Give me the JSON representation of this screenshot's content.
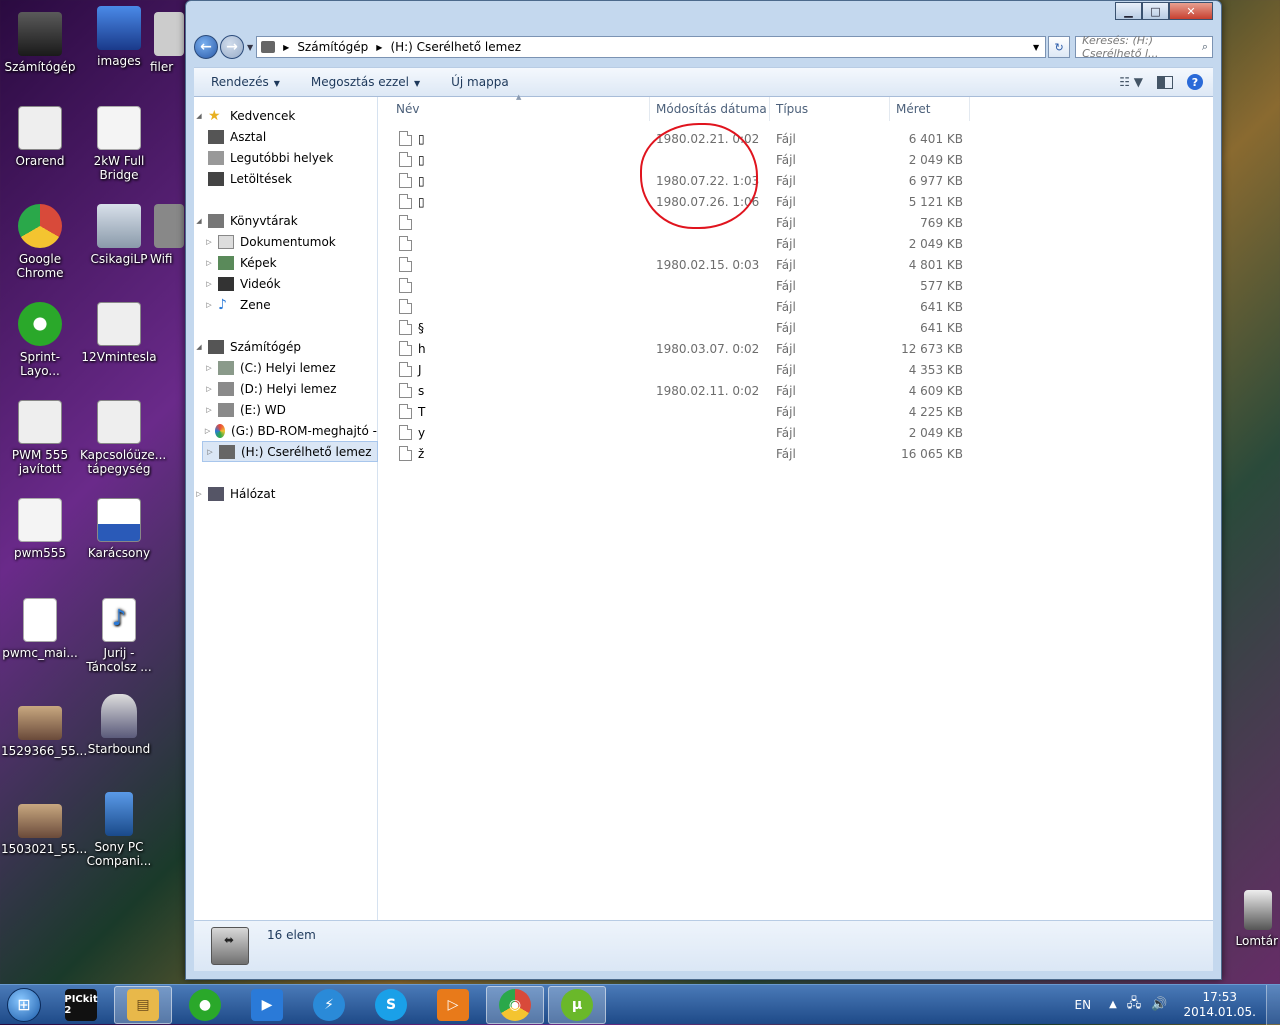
{
  "desktop": {
    "icons": [
      {
        "label": "Számítógép",
        "color": "#3a3a3a"
      },
      {
        "label": "images",
        "color": "#1a4a9a"
      },
      {
        "label": "filer",
        "color": "#cccccc"
      },
      {
        "label": "Orarend",
        "color": "#e8e8e8"
      },
      {
        "label": "2kW Full Bridge",
        "color": "#f0f0f0"
      },
      {
        "label": "Google Chrome",
        "color": "#d84a3a"
      },
      {
        "label": "CsikagiLP",
        "color": "#a8b8c8"
      },
      {
        "label": "Wifi",
        "color": "#888888"
      },
      {
        "label": "Sprint-Layo...",
        "color": "#2aa82a"
      },
      {
        "label": "12Vmintesla",
        "color": "#e0e0e0"
      },
      {
        "label": "PWM 555 javított",
        "color": "#e0e0e0"
      },
      {
        "label": "Kapcsolóüze... tápegység",
        "color": "#e0e0e0"
      },
      {
        "label": "pwm555",
        "color": "#f0f0f0"
      },
      {
        "label": "Karácsony",
        "color": "#2a5ab8"
      },
      {
        "label": "pwmc_mai...",
        "color": "#ffffff"
      },
      {
        "label": "Jurij - Táncolsz ...",
        "color": "#2a7ad8"
      },
      {
        "label": "1529366_55...",
        "color": "#8a5a4a"
      },
      {
        "label": "Starbound",
        "color": "#5a5a7a"
      },
      {
        "label": "1503021_55...",
        "color": "#8a5a4a"
      },
      {
        "label": "Sony PC Compani...",
        "color": "#2a6ab8"
      },
      {
        "label": "Lomtár",
        "color": "#6a6a6a"
      }
    ]
  },
  "window": {
    "controls": {
      "minimize": "▁",
      "maximize": "□",
      "close": "✕"
    },
    "address": {
      "root": "Számítógép",
      "current": "(H:) Cserélhető lemez"
    },
    "search": {
      "placeholder": "Keresés: (H:) Cserélhető l..."
    },
    "toolbar": {
      "organize": "Rendezés",
      "share": "Megosztás ezzel",
      "new_folder": "Új mappa"
    },
    "nav": {
      "favorites": "Kedvencek",
      "desktop": "Asztal",
      "recent": "Legutóbbi helyek",
      "downloads": "Letöltések",
      "libraries": "Könyvtárak",
      "documents": "Dokumentumok",
      "pictures": "Képek",
      "videos": "Videók",
      "music": "Zene",
      "computer": "Számítógép",
      "drive_c": "(C:) Helyi lemez",
      "drive_d": "(D:) Helyi lemez",
      "drive_e": "(E:) WD",
      "drive_g": "(G:) BD-ROM-meghajtó -",
      "drive_h": "(H:) Cserélhető lemez",
      "network": "Hálózat"
    },
    "columns": {
      "name": "Név",
      "date": "Módosítás dátuma",
      "type": "Típus",
      "size": "Méret"
    },
    "files": [
      {
        "name": "▯",
        "date": "1980.02.21. 0:02",
        "type": "Fájl",
        "size": "6 401 KB"
      },
      {
        "name": "▯",
        "date": "",
        "type": "Fájl",
        "size": "2 049 KB"
      },
      {
        "name": "▯",
        "date": "1980.07.22. 1:03",
        "type": "Fájl",
        "size": "6 977 KB"
      },
      {
        "name": "▯",
        "date": "1980.07.26. 1:06",
        "type": "Fájl",
        "size": "5 121 KB"
      },
      {
        "name": "",
        "date": "",
        "type": "Fájl",
        "size": "769 KB"
      },
      {
        "name": "",
        "date": "",
        "type": "Fájl",
        "size": "2 049 KB"
      },
      {
        "name": "",
        "date": "1980.02.15. 0:03",
        "type": "Fájl",
        "size": "4 801 KB"
      },
      {
        "name": "",
        "date": "",
        "type": "Fájl",
        "size": "577 KB"
      },
      {
        "name": "",
        "date": "",
        "type": "Fájl",
        "size": "641 KB"
      },
      {
        "name": "§",
        "date": "",
        "type": "Fájl",
        "size": "641 KB"
      },
      {
        "name": "h",
        "date": "1980.03.07. 0:02",
        "type": "Fájl",
        "size": "12 673 KB"
      },
      {
        "name": "J",
        "date": "",
        "type": "Fájl",
        "size": "4 353 KB"
      },
      {
        "name": "s",
        "date": "1980.02.11. 0:02",
        "type": "Fájl",
        "size": "4 609 KB"
      },
      {
        "name": "T",
        "date": "",
        "type": "Fájl",
        "size": "4 225 KB"
      },
      {
        "name": "y",
        "date": "",
        "type": "Fájl",
        "size": "2 049 KB"
      },
      {
        "name": "ž",
        "date": "",
        "type": "Fájl",
        "size": "16 065 KB"
      }
    ],
    "status": {
      "count": "16 elem"
    }
  },
  "taskbar": {
    "apps": [
      {
        "name": "pickit",
        "label": "PICkit 2",
        "color": "#111111",
        "active": false
      },
      {
        "name": "explorer",
        "label": "▤",
        "color": "#e8b84a",
        "active": true
      },
      {
        "name": "sprint-layout",
        "label": "●",
        "color": "#2aa82a",
        "active": false
      },
      {
        "name": "media-player",
        "label": "▶",
        "color": "#2a7ad8",
        "active": false
      },
      {
        "name": "flash",
        "label": "⚡",
        "color": "#2a8ad8",
        "active": false
      },
      {
        "name": "skype",
        "label": "S",
        "color": "#1aa0e8",
        "active": false
      },
      {
        "name": "media-center",
        "label": "▷",
        "color": "#e87a1a",
        "active": false
      },
      {
        "name": "chrome",
        "label": "◉",
        "color": "#d84a3a",
        "active": true
      },
      {
        "name": "utorrent",
        "label": "µ",
        "color": "#6ab82a",
        "active": true
      }
    ],
    "lang": "EN",
    "time": "17:53",
    "date": "2014.01.05."
  },
  "colors": {
    "annotation": "#e0141e",
    "accent": "#2a6ad8"
  }
}
